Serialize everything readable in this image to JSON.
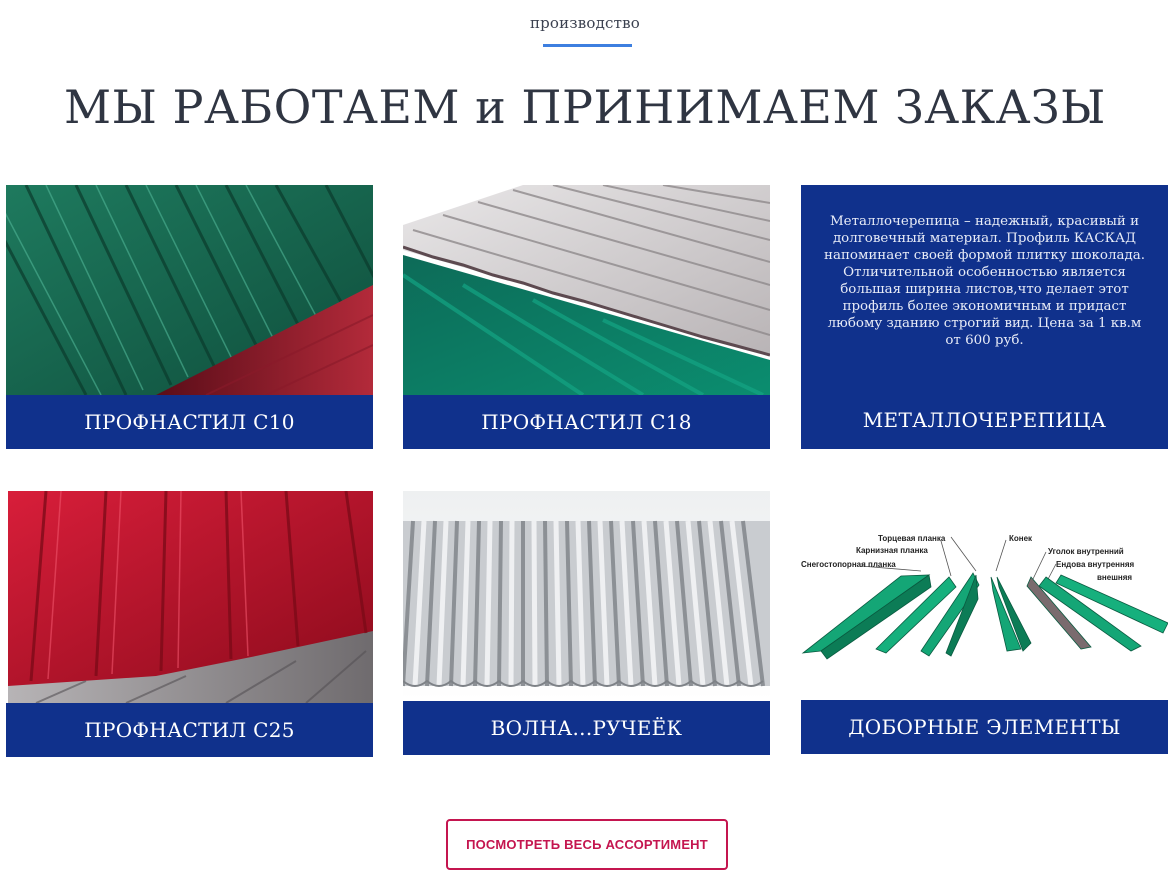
{
  "header": {
    "subtitle": "производство",
    "title": "МЫ РАБОТАЕМ и ПРИНИМАЕМ ЗАКАЗЫ"
  },
  "cards": [
    {
      "label": "ПРОФНАСТИЛ С10",
      "image": "green-corrugated-sheet"
    },
    {
      "label": "ПРОФНАСТИЛ С18",
      "image": "grey-green-corrugated-sheets"
    },
    {
      "label": "МЕТАЛЛОЧЕРЕПИЦА",
      "description": "Металлочерепица – надежный, красивый и долговечный материал. Профиль КАСКАД напоминает своей формой плитку шоколада. Отличительной особенностью является большая ширина листов,что делает этот профиль более экономичным и придаст любому зданию строгий вид. Цена за 1 кв.м от 600 руб."
    },
    {
      "label": "ПРОФНАСТИЛ С25",
      "image": "red-corrugated-sheet"
    },
    {
      "label": "ВОЛНА...РУЧЕЁК",
      "image": "wave-galvanized-sheet"
    },
    {
      "label": "ДОБОРНЫЕ ЭЛЕМЕНТЫ",
      "image": "roof-trim-elements-diagram",
      "diagram_labels": [
        "Торцевая планка",
        "Карнизная планка",
        "Снегостопорная планка",
        "Конек",
        "Уголок внутренний",
        "Ендова внутренняя",
        "внешняя"
      ]
    }
  ],
  "cta": {
    "label": "ПОСМОТРЕТЬ ВЕСЬ АССОРТИМЕНТ"
  },
  "colors": {
    "accent_blue": "#10318c",
    "button_red": "#c4154f",
    "underline": "#3d7fe0"
  }
}
